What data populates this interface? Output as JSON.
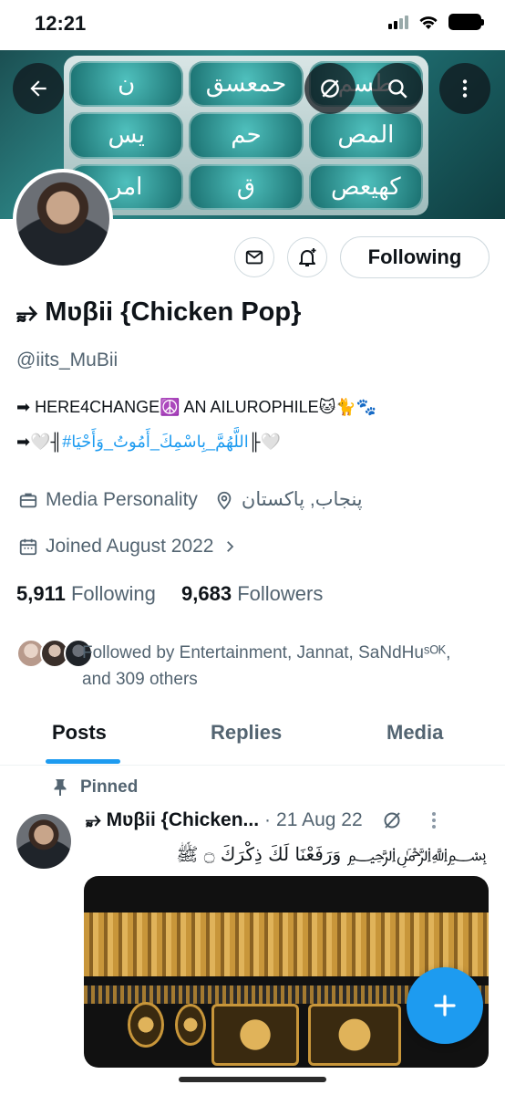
{
  "status_bar": {
    "time": "12:21"
  },
  "header": {
    "banner_tiles": [
      "ن",
      "حمعسق",
      "طسم",
      "يس",
      "حم",
      "المص",
      "امر",
      "ق",
      "كهيعص"
    ]
  },
  "actions": {
    "following_label": "Following"
  },
  "profile": {
    "name": "⥵ Mʋβii {Chicken Pop}",
    "handle": "@iits_MuBii",
    "bio_line1": "➡ HERE4CHANGE☮️ AN AILUROPHILE🐱🐈🐾",
    "bio_line2_prefix": "➡🤍╢",
    "bio_line2_hashtag": "#اللَّهُمَّ_بِاسْمِكَ_أَمُوتُ_وَأَحْيَا",
    "bio_line2_suffix": "╟🤍",
    "category": "Media Personality",
    "location": "پنجاب, پاکستان",
    "joined": "Joined August 2022",
    "following_count": "5,911",
    "following_label": "Following",
    "followers_count": "9,683",
    "followers_label": "Followers",
    "followed_by": "Followed by Entertainment, Jannat, SaNdHuˢᴼᴷ, and 309 others"
  },
  "tabs": [
    "Posts",
    "Replies",
    "Media"
  ],
  "pinned_post": {
    "pinned_label": "Pinned",
    "author": "⥵ Mʋβii {Chicken...",
    "separator": "·",
    "date": "21 Aug 22",
    "text": "﷽ وَرَفَعْنَا لَكَ ذِكْرَكَ ۝ ﷺ"
  },
  "colors": {
    "accent": "#1d9bf0",
    "secondary_text": "#536471",
    "primary_text": "#0f1419"
  }
}
